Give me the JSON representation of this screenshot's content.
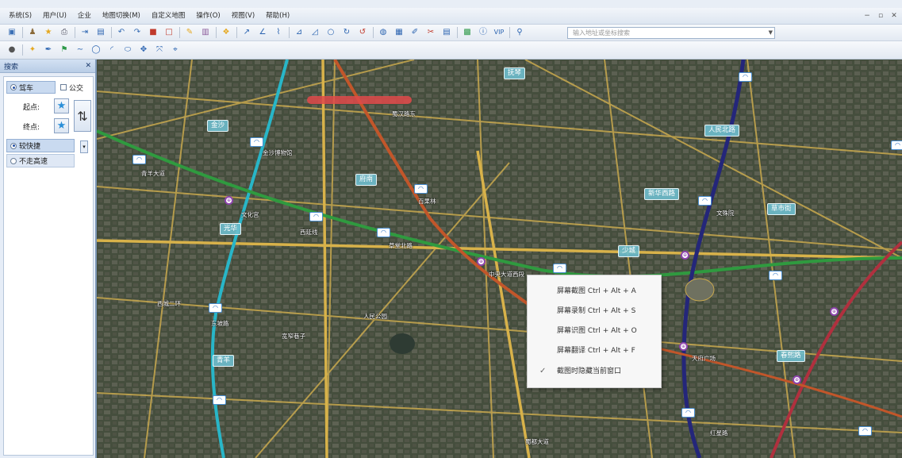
{
  "menubar": {
    "items": [
      "系统(S)",
      "用户(U)",
      "企业",
      "地图切换(M)",
      "自定义地图",
      "操作(O)",
      "视图(V)",
      "帮助(H)"
    ]
  },
  "toolbar": {
    "search_placeholder": "输入地址或坐标搜索"
  },
  "search_panel": {
    "title": "搜索",
    "close": "✕",
    "mode_drive": "驾车",
    "mode_transit": "公交",
    "start_label": "起点:",
    "end_label": "终点:",
    "option_shortest": "较快捷",
    "option_no_highway": "不走高速"
  },
  "map": {
    "area_labels": [
      "抚琴",
      "金沙",
      "府南",
      "新华西路",
      "人民北路",
      "草市街",
      "光华",
      "少城",
      "春熙路",
      "青羊"
    ],
    "road_labels": [
      "蜀汉路东",
      "文化宫",
      "金沙博物馆",
      "西延线",
      "草堂北路",
      "中央大道西段",
      "百果林",
      "东坡路",
      "西城二环",
      "青羊大道",
      "蜀都大道",
      "文殊院",
      "天府广场",
      "红星路",
      "人民公园",
      "宽窄巷子"
    ]
  },
  "context_menu": {
    "items": [
      {
        "label": "屏幕截图 Ctrl + Alt + A",
        "checked": false
      },
      {
        "label": "屏幕录制 Ctrl + Alt + S",
        "checked": false
      },
      {
        "label": "屏幕识图 Ctrl + Alt + O",
        "checked": false
      },
      {
        "label": "屏幕翻译 Ctrl + Alt + F",
        "checked": false
      },
      {
        "label": "截图时隐藏当前窗口",
        "checked": true
      }
    ]
  },
  "colors": {
    "accent": "#2a8fd8",
    "metro_purple": "#8e44ad",
    "road_yellow": "#d8b24a",
    "area_label": "#6ebecd"
  }
}
